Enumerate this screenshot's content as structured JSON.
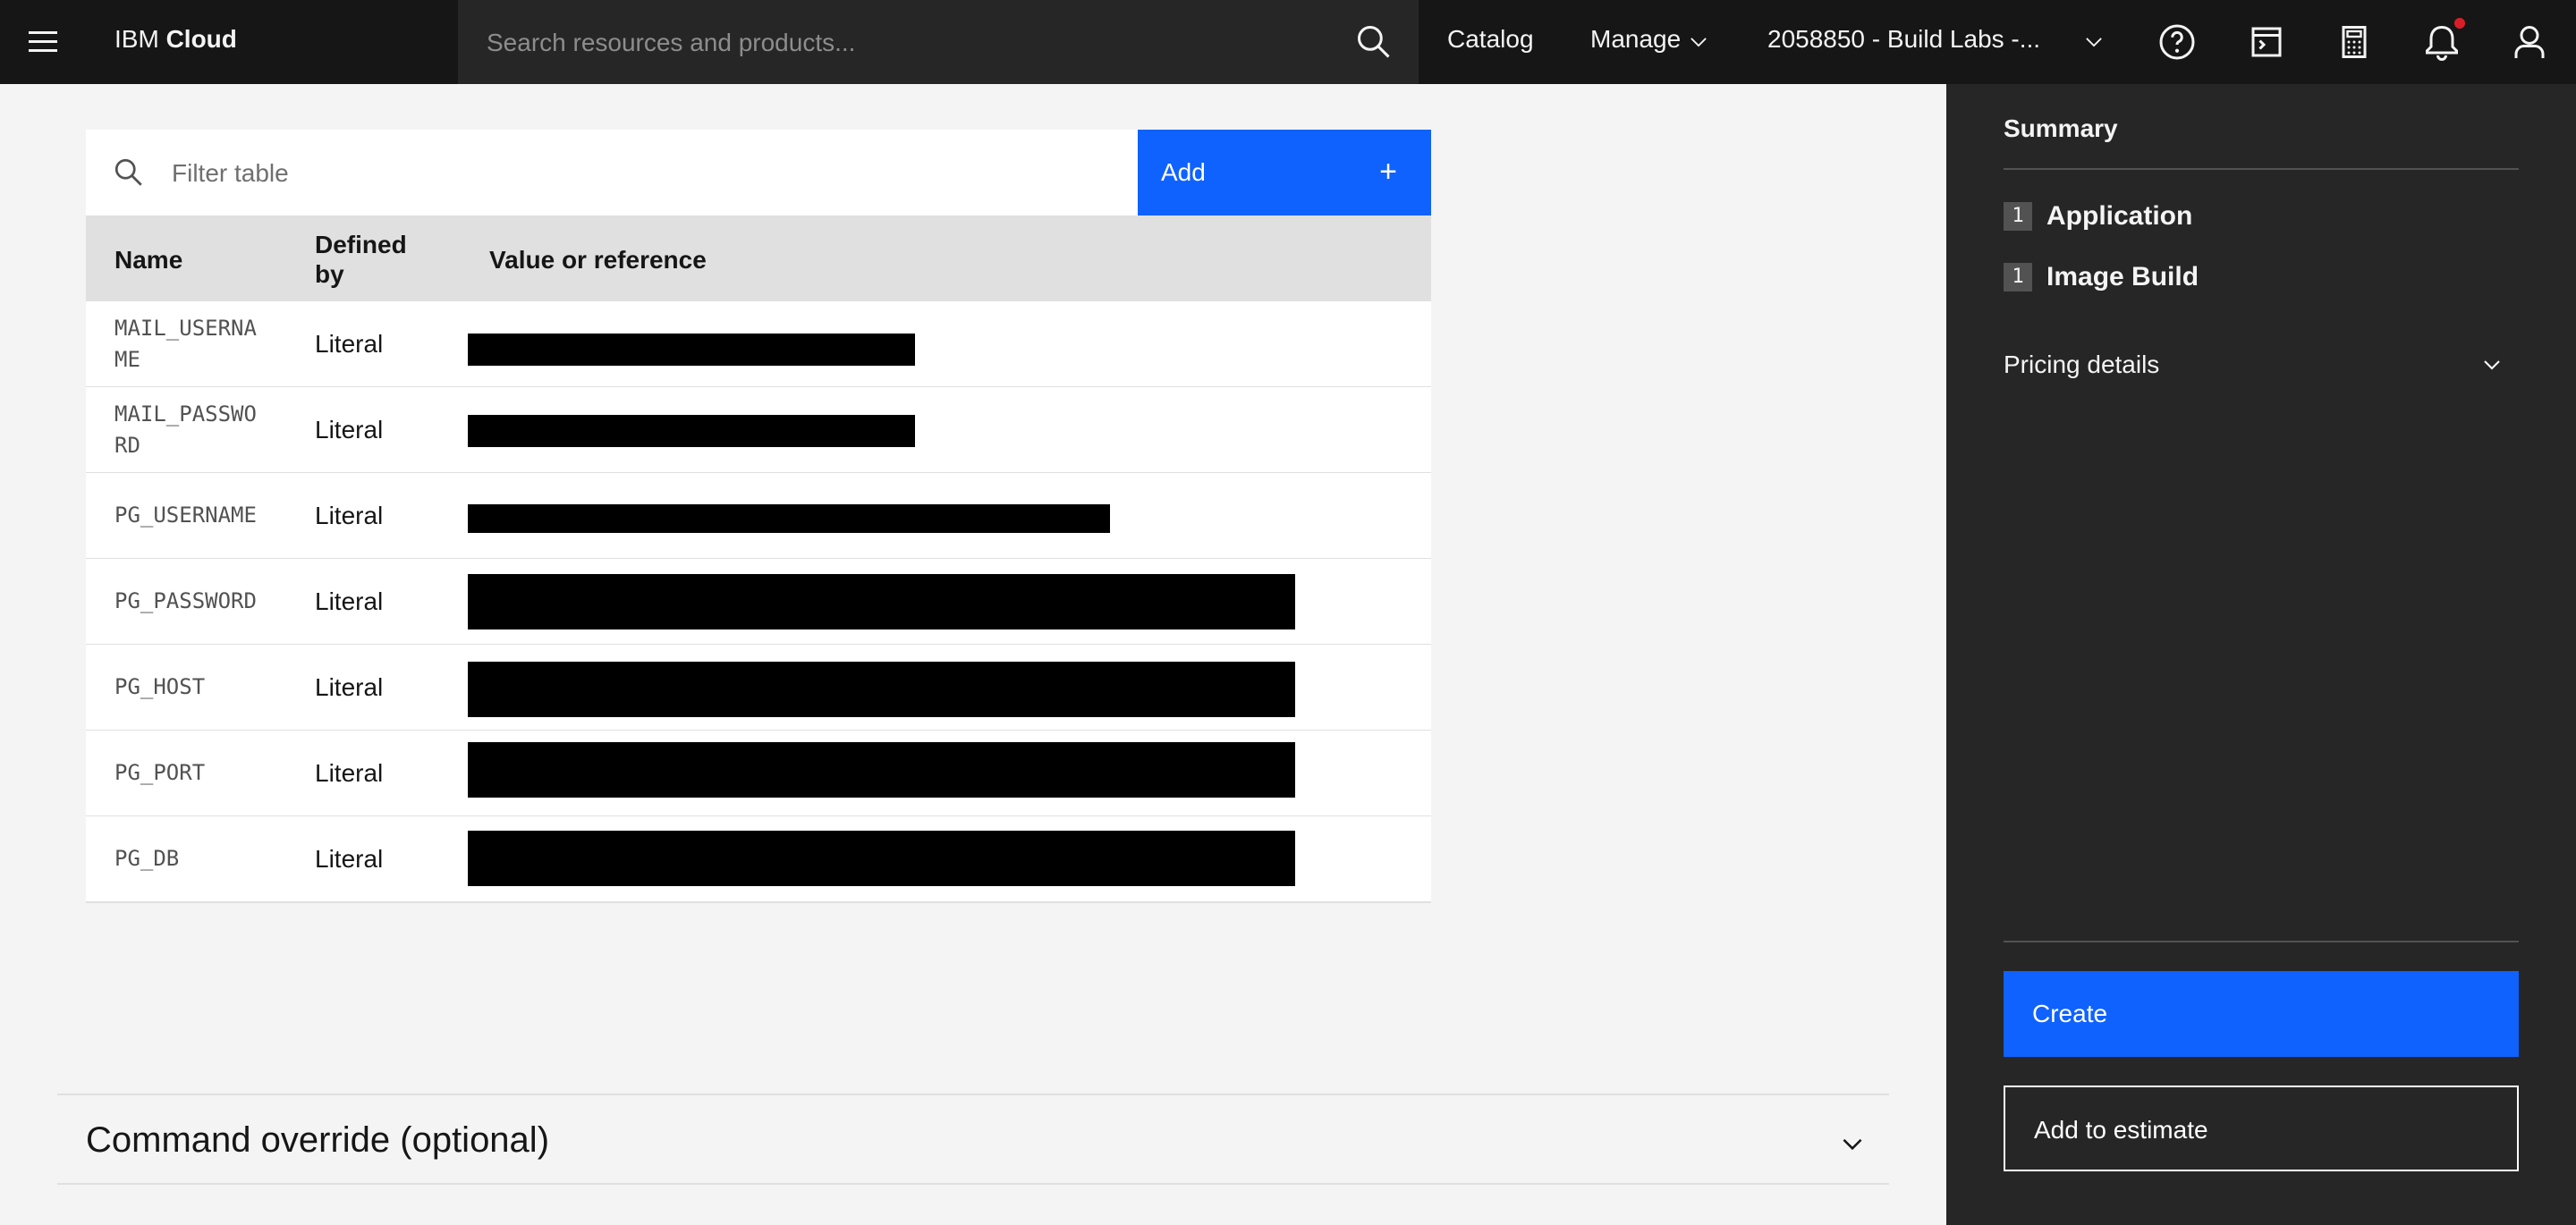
{
  "header": {
    "brand_prefix": "IBM",
    "brand_name": "Cloud",
    "search_placeholder": "Search resources and products...",
    "catalog_label": "Catalog",
    "manage_label": "Manage",
    "account_label": "2058850 - Build Labs -...",
    "icons": [
      "menu-icon",
      "search-icon",
      "chevron-down-icon",
      "help-icon",
      "terminal-icon",
      "calculator-icon",
      "notification-icon",
      "user-icon"
    ],
    "notification_dot_color": "#da1e28"
  },
  "table": {
    "filter_placeholder": "Filter table",
    "add_label": "Add",
    "add_icon": "+",
    "columns": [
      "Name",
      "Defined by",
      "Value or reference"
    ],
    "rows": [
      {
        "name": "MAIL_USERNAME",
        "defined_by": "Literal"
      },
      {
        "name": "MAIL_PASSWORD",
        "defined_by": "Literal"
      },
      {
        "name": "PG_USERNAME",
        "defined_by": "Literal"
      },
      {
        "name": "PG_PASSWORD",
        "defined_by": "Literal"
      },
      {
        "name": "PG_HOST",
        "defined_by": "Literal"
      },
      {
        "name": "PG_PORT",
        "defined_by": "Literal"
      },
      {
        "name": "PG_DB",
        "defined_by": "Literal"
      }
    ]
  },
  "command_override": {
    "title": "Command override (optional)"
  },
  "summary": {
    "title": "Summary",
    "items": [
      {
        "count": "1",
        "label": "Application"
      },
      {
        "count": "1",
        "label": "Image Build"
      }
    ],
    "pricing_label": "Pricing details",
    "create_label": "Create",
    "estimate_label": "Add to estimate"
  },
  "colors": {
    "primary_blue": "#0f62fe",
    "header_bg": "#161616",
    "panel_bg": "#262626"
  }
}
